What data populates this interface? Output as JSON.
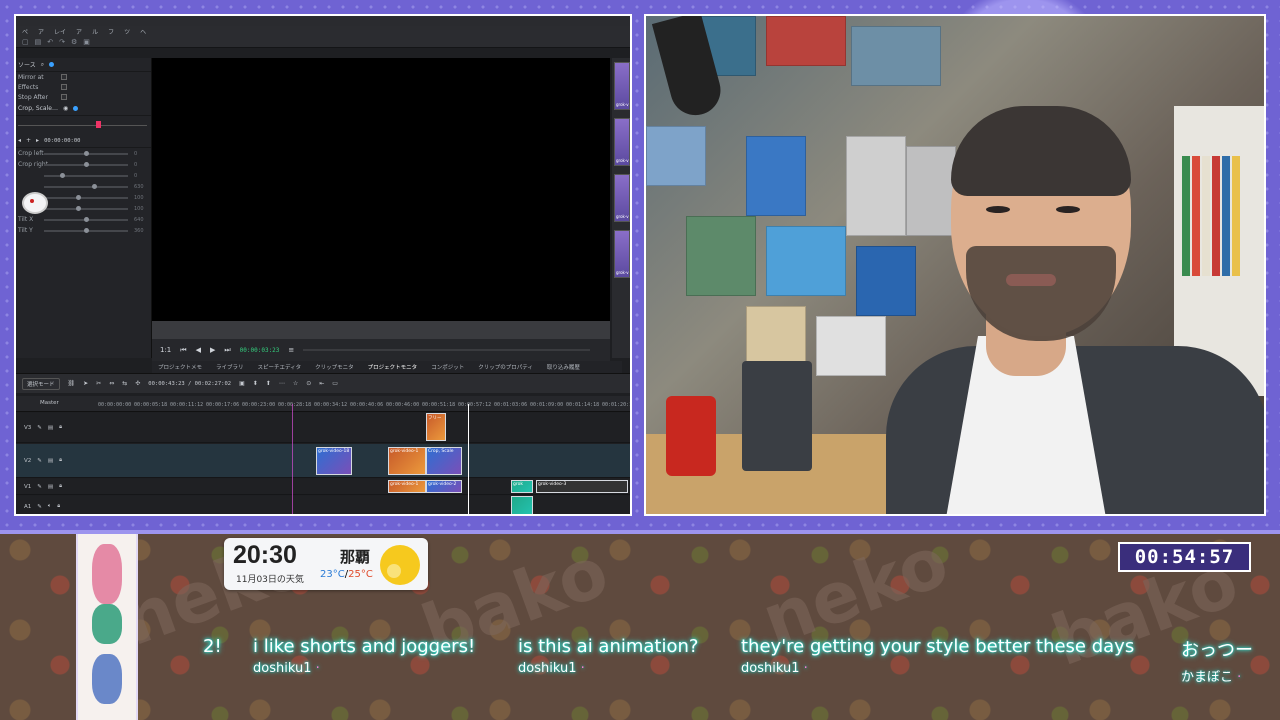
{
  "editor": {
    "menu": [
      "ペ",
      "ア",
      "レイ",
      "ア",
      "ル",
      "フ",
      "ツ",
      "ヘ"
    ],
    "transport_timecode": "00:00:03:23",
    "source_timecode": "00:00:00:00",
    "panel_header": "ソース",
    "effect_header": "Crop, Scale…",
    "props": [
      "Mirror at",
      "Effects",
      "Stop After"
    ],
    "sliders": [
      {
        "label": "Crop left",
        "value": "0",
        "pos": 0.5
      },
      {
        "label": "Crop right",
        "value": "0",
        "pos": 0.5
      },
      {
        "label": "",
        "value": "0",
        "pos": 0.2
      },
      {
        "label": "",
        "value": "630",
        "pos": 0.6
      },
      {
        "label": "",
        "value": "100",
        "pos": 0.4
      },
      {
        "label": "",
        "value": "100",
        "pos": 0.4
      },
      {
        "label": "Tilt X",
        "value": "640",
        "pos": 0.5
      },
      {
        "label": "Tilt Y",
        "value": "360",
        "pos": 0.5
      }
    ],
    "keyframe_timecode": "00:00:00:00",
    "tabs": [
      "プロジェクトメモ",
      "ライブラリ",
      "スピーチエディタ",
      "クリップモニタ",
      "プロジェクトモニタ",
      "コンポジット",
      "クリップのプロパティ",
      "取り込み履歴"
    ],
    "active_tab_index": 4,
    "tl_mode": "選択モード",
    "tl_timecode": "00:00:43:23 / 00:02:27:02",
    "master_label": "Master",
    "ruler_ticks": [
      "00:00:00:00",
      "00:00:05:18",
      "00:00:11:12",
      "00:00:17:06",
      "00:00:23:00",
      "00:00:28:18",
      "00:00:34:12",
      "00:00:40:06",
      "00:00:46:00",
      "00:00:51:18",
      "00:00:57:12",
      "00:01:03:06",
      "00:01:09:00",
      "00:01:14:18",
      "00:01:20:12"
    ],
    "tracks": [
      {
        "name": "V3"
      },
      {
        "name": "V2"
      },
      {
        "name": "V1"
      },
      {
        "name": "A1"
      }
    ],
    "clip_labels": [
      "grok-video-18",
      "grok-video-1",
      "grok-video-1",
      "Crop, Scale",
      "フリー",
      "grok-video-2",
      "grok",
      "grok-video-3"
    ],
    "thumbs": [
      "grok-v",
      "grok-v",
      "grok-v",
      "grok-v"
    ]
  },
  "weather": {
    "time": "20:30",
    "date": "11月03日の天気",
    "city": "那覇",
    "temp_low": "23°C",
    "temp_sep": "/",
    "temp_high": "25°C",
    "icon": "sun-icon"
  },
  "timer": "00:54:57",
  "chat": [
    {
      "msg": "2!",
      "user": ""
    },
    {
      "msg": "i like shorts and joggers!",
      "user": "doshiku1"
    },
    {
      "msg": "is this ai animation?",
      "user": "doshiku1"
    },
    {
      "msg": "they're getting your style better these days",
      "user": "doshiku1"
    },
    {
      "msg": "おっつー",
      "user": "かまぼこ"
    }
  ],
  "colors": {
    "frame": "#6f63d3",
    "chat_glow": "#2ff0e0",
    "timer_bg": "#3a2e7c",
    "weather_hi": "#e04c2c",
    "weather_lo": "#2a7bd6"
  }
}
